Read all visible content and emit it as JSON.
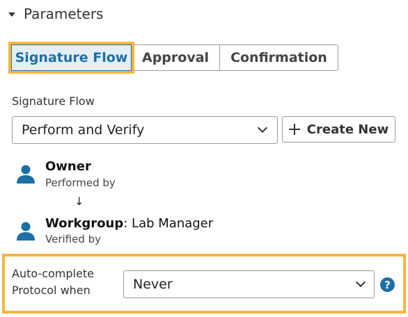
{
  "section": {
    "title": "Parameters"
  },
  "tabs": [
    {
      "label": "Signature Flow",
      "active": true
    },
    {
      "label": "Approval",
      "active": false
    },
    {
      "label": "Confirmation",
      "active": false
    }
  ],
  "signature_flow": {
    "label": "Signature Flow",
    "selected": "Perform and Verify",
    "create_label": "Create New"
  },
  "steps": [
    {
      "role": "Owner",
      "suffix": "",
      "subtitle": "Performed by"
    },
    {
      "role": "Workgroup",
      "suffix": ": Lab Manager",
      "subtitle": "Verified by"
    }
  ],
  "flow_arrow": "↓",
  "auto_complete": {
    "label": "Auto-complete Protocol when",
    "selected": "Never",
    "help_glyph": "?"
  },
  "colors": {
    "accent": "#1d6fa6",
    "highlight": "#f8b63a"
  },
  "icons": {
    "section_toggle": "caret-down-icon",
    "person": "person-icon",
    "help": "help-icon",
    "dropdown": "chevron-down-icon",
    "create": "plus-icon"
  }
}
